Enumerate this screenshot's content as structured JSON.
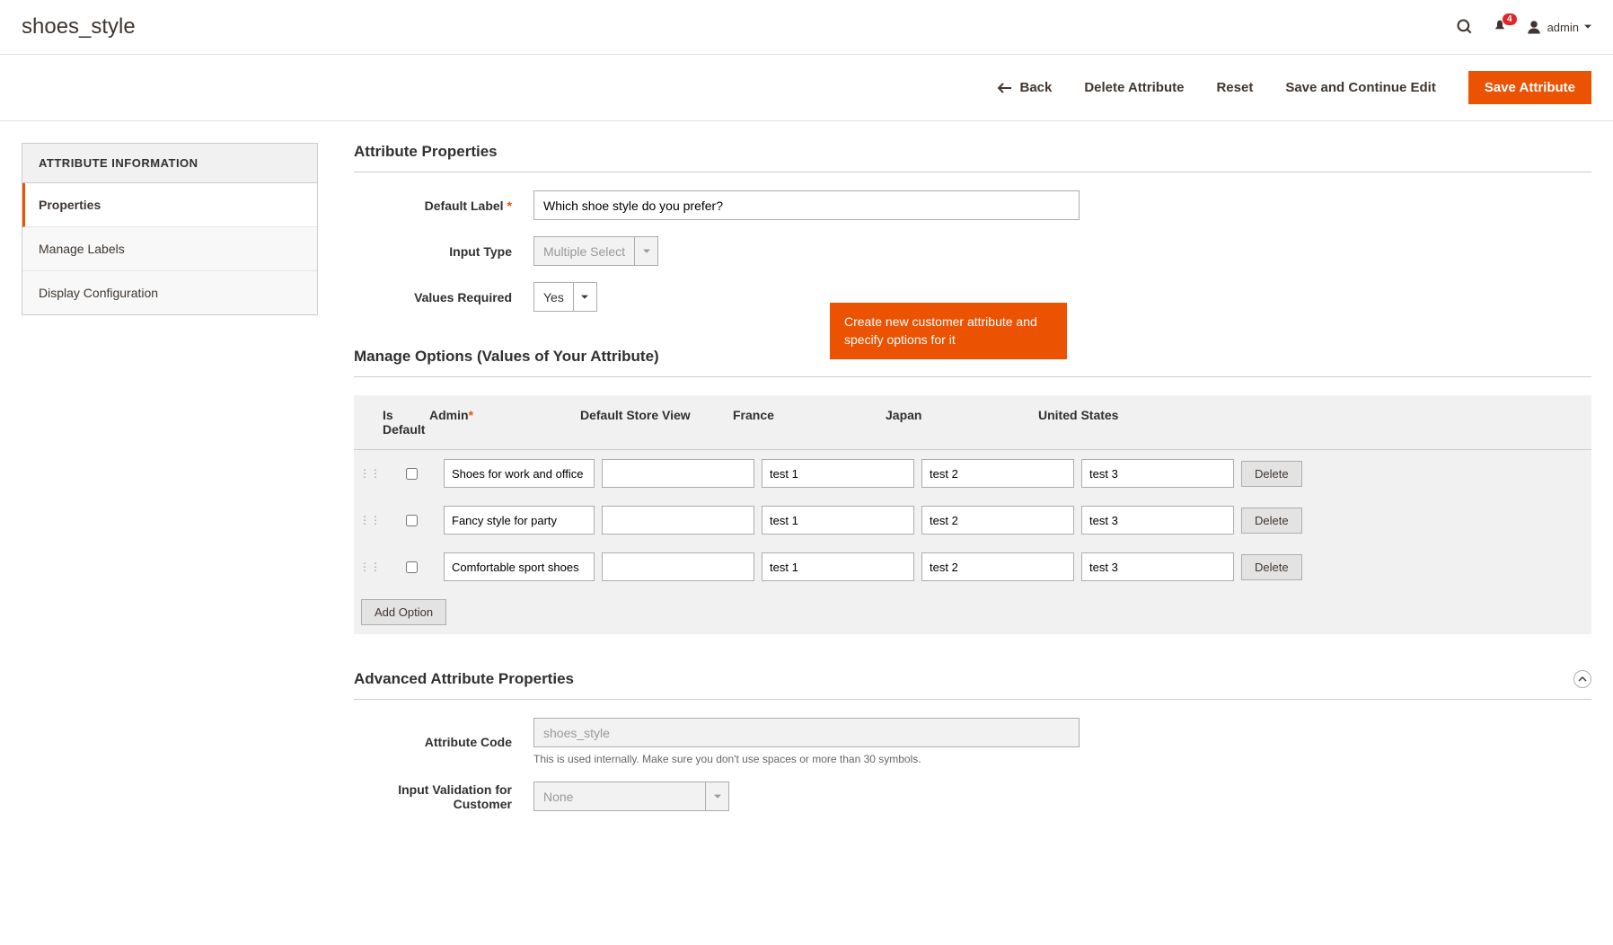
{
  "header": {
    "title": "shoes_style",
    "notification_count": "4",
    "admin_label": "admin"
  },
  "actions": {
    "back": "Back",
    "delete": "Delete Attribute",
    "reset": "Reset",
    "save_continue": "Save and Continue Edit",
    "save": "Save Attribute"
  },
  "sidebar": {
    "header": "ATTRIBUTE INFORMATION",
    "tabs": [
      "Properties",
      "Manage Labels",
      "Display Configuration"
    ]
  },
  "properties": {
    "section_title": "Attribute Properties",
    "default_label_label": "Default Label",
    "default_label_value": "Which shoe style do you prefer?",
    "input_type_label": "Input Type",
    "input_type_value": "Multiple Select",
    "values_required_label": "Values Required",
    "values_required_value": "Yes"
  },
  "callout_text": "Create new customer attribute and specify options for it",
  "manage_options": {
    "title": "Manage Options (Values of Your Attribute)",
    "headers": {
      "is_default": "Is Default",
      "admin": "Admin",
      "default_store": "Default Store View",
      "france": "France",
      "japan": "Japan",
      "us": "United States"
    },
    "rows": [
      {
        "admin": "Shoes for work and office",
        "default_store": "",
        "france": "test 1",
        "japan": "test 2",
        "us": "test 3"
      },
      {
        "admin": "Fancy style for party",
        "default_store": "",
        "france": "test 1",
        "japan": "test 2",
        "us": "test 3"
      },
      {
        "admin": "Comfortable sport shoes",
        "default_store": "",
        "france": "test 1",
        "japan": "test 2",
        "us": "test 3"
      }
    ],
    "delete_label": "Delete",
    "add_option_label": "Add Option"
  },
  "advanced": {
    "title": "Advanced Attribute Properties",
    "attribute_code_label": "Attribute Code",
    "attribute_code_value": "shoes_style",
    "attribute_code_help": "This is used internally. Make sure you don't use spaces or more than 30 symbols.",
    "input_validation_label": "Input Validation for Customer",
    "input_validation_value": "None"
  }
}
